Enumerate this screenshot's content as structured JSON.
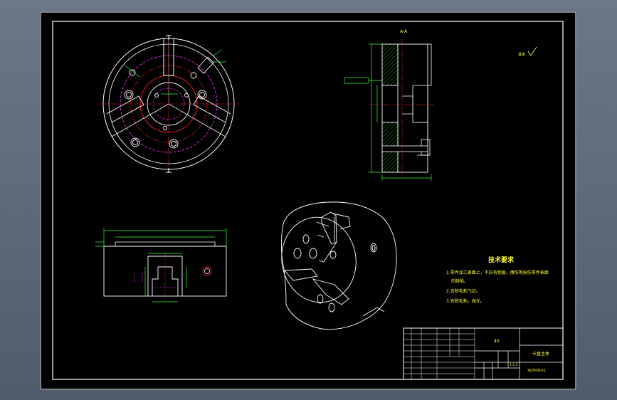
{
  "drawing": {
    "section_label_top": "A-A",
    "roughness_note": "其余",
    "title_block": {
      "material": "45",
      "part_name": "卡盘主体",
      "drawing_no": "XJ2008-01",
      "scale": "1:1.5"
    },
    "tech_requirements": {
      "title": "技术要求",
      "items": [
        "1.零件加工表面上，不应有划痕、擦伤等损伤零件表面",
        "的缺陷。",
        "2.去除毛刺飞边。",
        "3.去除毛刺，抛光。"
      ]
    }
  },
  "colors": {
    "background": "#000000",
    "frame": "#ffffff",
    "geometry": "#ffffff",
    "center_line": "#ff2020",
    "hidden_line": "#ff33ff",
    "dimension": "#33ff33",
    "hatch": "#33ff33",
    "text": "#ffff33"
  }
}
